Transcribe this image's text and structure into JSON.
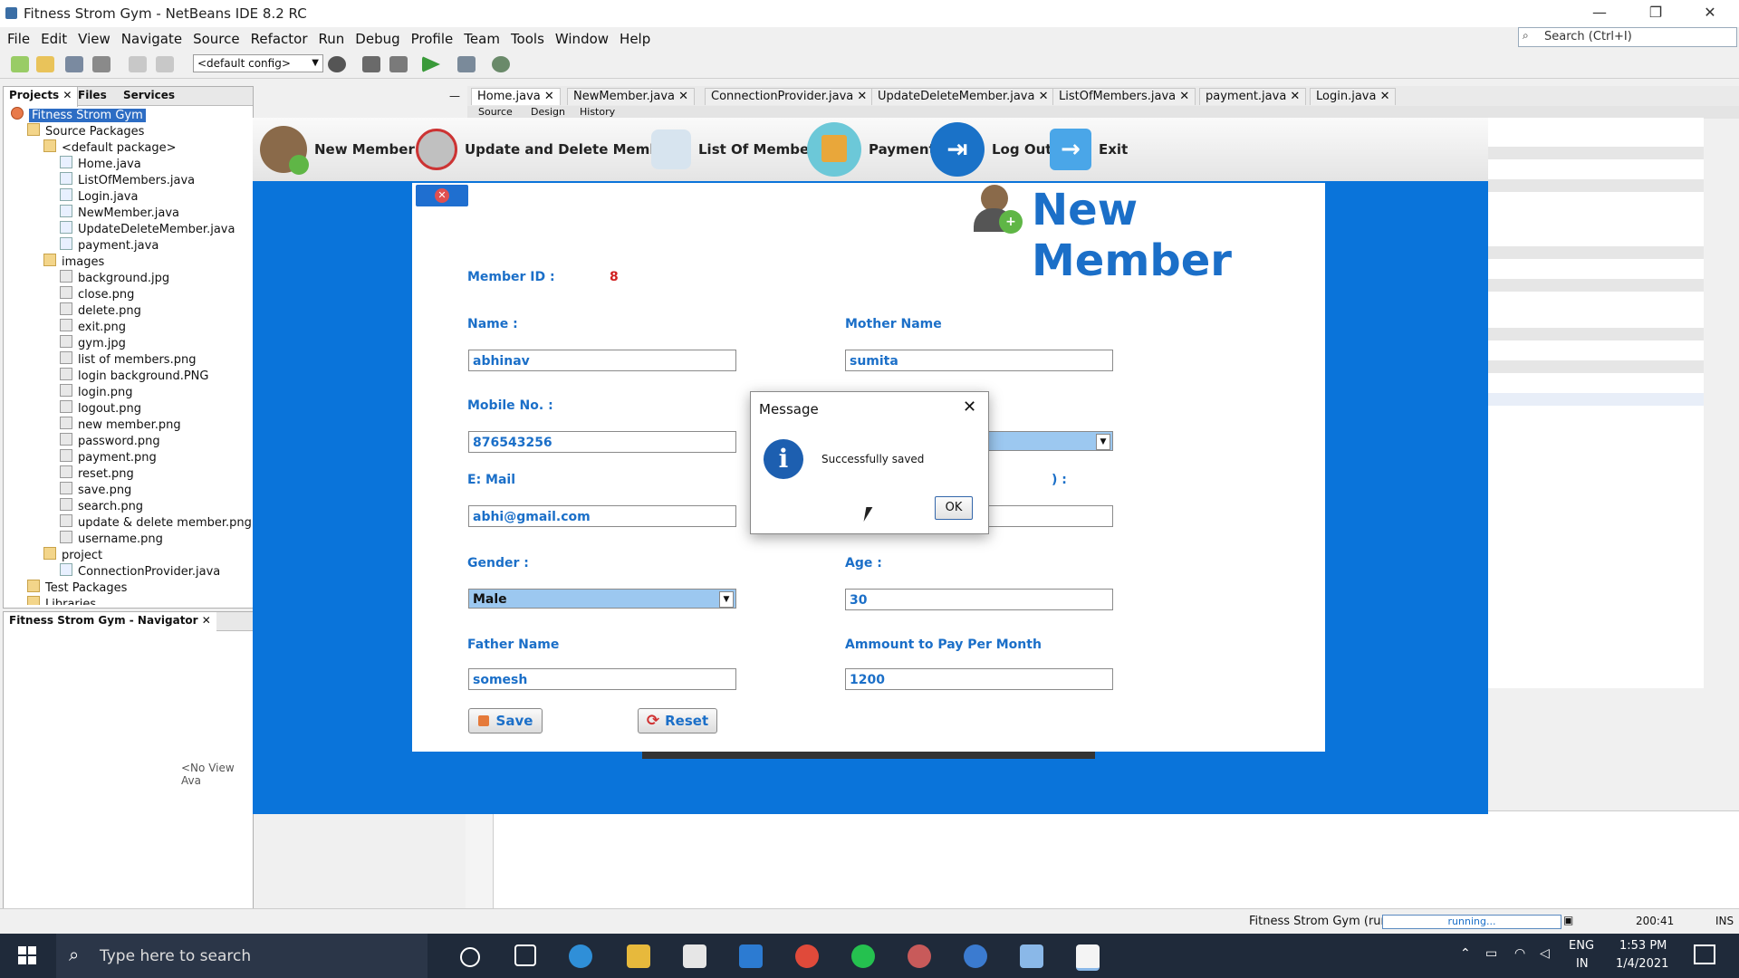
{
  "window": {
    "title": "Fitness Strom Gym - NetBeans IDE 8.2 RC",
    "search_placeholder": "Search (Ctrl+I)"
  },
  "menu": [
    "File",
    "Edit",
    "View",
    "Navigate",
    "Source",
    "Refactor",
    "Run",
    "Debug",
    "Profile",
    "Team",
    "Tools",
    "Window",
    "Help"
  ],
  "toolbar": {
    "config": "<default config>"
  },
  "panels": {
    "tabs": [
      "Projects",
      "Files",
      "Services"
    ],
    "navigator_title": "Fitness Strom Gym - Navigator",
    "navigator_empty": "<No View Ava"
  },
  "tree": [
    {
      "label": "Fitness Strom Gym",
      "type": "root",
      "level": 0,
      "selected": true
    },
    {
      "label": "Source Packages",
      "type": "pkg",
      "level": 1
    },
    {
      "label": "<default package>",
      "type": "pkg",
      "level": 2
    },
    {
      "label": "Home.java",
      "type": "java",
      "level": 3
    },
    {
      "label": "ListOfMembers.java",
      "type": "java",
      "level": 3
    },
    {
      "label": "Login.java",
      "type": "java",
      "level": 3
    },
    {
      "label": "NewMember.java",
      "type": "java",
      "level": 3
    },
    {
      "label": "UpdateDeleteMember.java",
      "type": "java",
      "level": 3
    },
    {
      "label": "payment.java",
      "type": "java",
      "level": 3
    },
    {
      "label": "images",
      "type": "pkg",
      "level": 2
    },
    {
      "label": "background.jpg",
      "type": "img",
      "level": 3
    },
    {
      "label": "close.png",
      "type": "img",
      "level": 3
    },
    {
      "label": "delete.png",
      "type": "img",
      "level": 3
    },
    {
      "label": "exit.png",
      "type": "img",
      "level": 3
    },
    {
      "label": "gym.jpg",
      "type": "img",
      "level": 3
    },
    {
      "label": "list of members.png",
      "type": "img",
      "level": 3
    },
    {
      "label": "login background.PNG",
      "type": "img",
      "level": 3
    },
    {
      "label": "login.png",
      "type": "img",
      "level": 3
    },
    {
      "label": "logout.png",
      "type": "img",
      "level": 3
    },
    {
      "label": "new member.png",
      "type": "img",
      "level": 3
    },
    {
      "label": "password.png",
      "type": "img",
      "level": 3
    },
    {
      "label": "payment.png",
      "type": "img",
      "level": 3
    },
    {
      "label": "reset.png",
      "type": "img",
      "level": 3
    },
    {
      "label": "save.png",
      "type": "img",
      "level": 3
    },
    {
      "label": "search.png",
      "type": "img",
      "level": 3
    },
    {
      "label": "update & delete member.png",
      "type": "img",
      "level": 3
    },
    {
      "label": "username.png",
      "type": "img",
      "level": 3
    },
    {
      "label": "project",
      "type": "pkg",
      "level": 2
    },
    {
      "label": "ConnectionProvider.java",
      "type": "java",
      "level": 3
    },
    {
      "label": "Test Packages",
      "type": "pkg",
      "level": 1
    },
    {
      "label": "Libraries",
      "type": "pkg",
      "level": 1
    }
  ],
  "editor": {
    "tabs": [
      "Home.java",
      "NewMember.java",
      "ConnectionProvider.java",
      "UpdateDeleteMember.java",
      "ListOfMembers.java",
      "payment.java",
      "Login.java"
    ],
    "subtabs": [
      "Source",
      "Design",
      "History"
    ]
  },
  "app": {
    "nav": [
      "New Member",
      "Update and Delete Member",
      "List Of Members",
      "Payment",
      "Log Out",
      "Exit"
    ],
    "heading": "New Member",
    "member_id_label": "Member ID :",
    "member_id": "8",
    "fields": {
      "name_label": "Name :",
      "name": "abhinav",
      "mother_label": "Mother Name",
      "mother": "sumita",
      "mobile_label": "Mobile No. :",
      "mobile": "876543256",
      "email_label": "E: Mail",
      "email": "abhi@gmail.com",
      "gender_label": "Gender :",
      "gender": "Male",
      "age_label": "Age :",
      "age": "30",
      "father_label": "Father Name",
      "father": "somesh",
      "amount_label": "Ammount to Pay Per Month",
      "amount": "1200",
      "hidden_label_tail": ") :"
    },
    "save": "Save",
    "reset": "Reset"
  },
  "dialog": {
    "title": "Message",
    "text": "Successfully saved",
    "ok": "OK"
  },
  "status": {
    "run": "Fitness Strom Gym (run)",
    "progress": "running...",
    "position": "200:41",
    "mode": "INS"
  },
  "taskbar": {
    "search": "Type here to search",
    "lang1": "ENG",
    "lang2": "IN",
    "time": "1:53 PM",
    "date": "1/4/2021"
  }
}
